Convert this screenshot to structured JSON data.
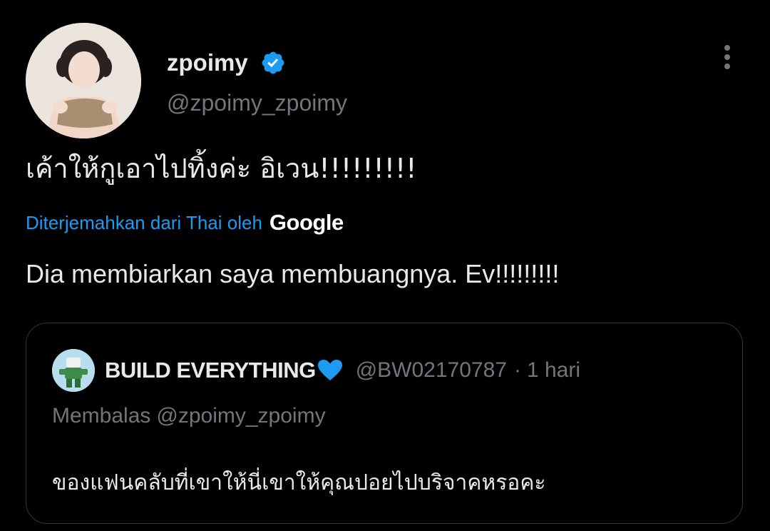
{
  "author": {
    "display_name": "zpoimy",
    "handle": "@zpoimy_zpoimy",
    "verified": true,
    "avatar_icon": "profile-photo"
  },
  "tweet": {
    "text": "เค้าให้กูเอาไปทิ้งค่ะ อิเวน!!!!!!!!!",
    "translated_by_label": "Diterjemahkan dari Thai oleh",
    "translation_provider": "Google",
    "translated_text": "Dia membiarkan saya membuangnya. Ev!!!!!!!!!"
  },
  "quoted_tweet": {
    "display_name": "BUILD EVERYTHING",
    "name_emoji_icon": "blue-heart-icon",
    "handle": "@BW02170787",
    "separator": "·",
    "time": "1 hari",
    "reply_label": "Membalas",
    "reply_to": "@zpoimy_zpoimy",
    "text": "ของแฟนคลับที่เขาให้นี่เขาให้คุณปอยไปบริจาคหรอคะ"
  },
  "colors": {
    "background": "#000000",
    "text_primary": "#e7e9ea",
    "text_secondary": "#71767b",
    "accent": "#1d9bf0",
    "border": "#333639",
    "heart": "#1d9bf0"
  }
}
